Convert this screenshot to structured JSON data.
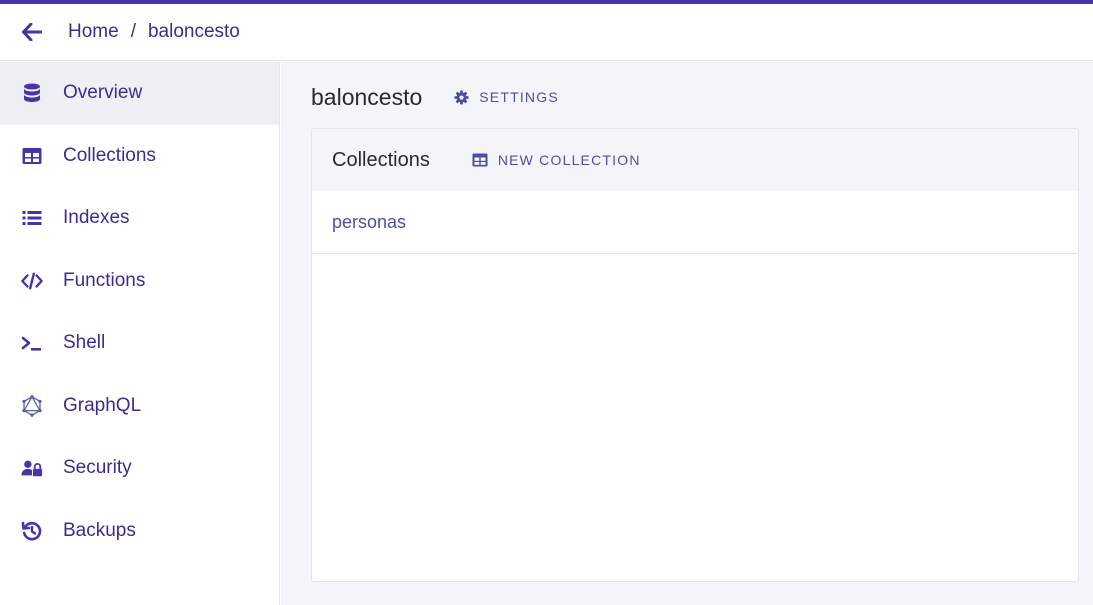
{
  "colors": {
    "accent": "#4a32a8",
    "nav_text": "#3d2c8f",
    "link": "#4d4da6",
    "active_bg": "#eef0f6",
    "main_bg": "#f4f5f9"
  },
  "breadcrumb": {
    "home": "Home",
    "separator": "/",
    "current": "baloncesto"
  },
  "sidebar": {
    "items": [
      {
        "label": "Overview",
        "icon": "database-icon"
      },
      {
        "label": "Collections",
        "icon": "table-icon"
      },
      {
        "label": "Indexes",
        "icon": "list-icon"
      },
      {
        "label": "Functions",
        "icon": "code-icon"
      },
      {
        "label": "Shell",
        "icon": "terminal-icon"
      },
      {
        "label": "GraphQL",
        "icon": "graphql-icon"
      },
      {
        "label": "Security",
        "icon": "user-lock-icon"
      },
      {
        "label": "Backups",
        "icon": "history-icon"
      }
    ]
  },
  "main": {
    "title": "baloncesto",
    "settings_label": "SETTINGS",
    "collections_card": {
      "title": "Collections",
      "new_label": "NEW COLLECTION",
      "items": [
        "personas"
      ]
    }
  }
}
